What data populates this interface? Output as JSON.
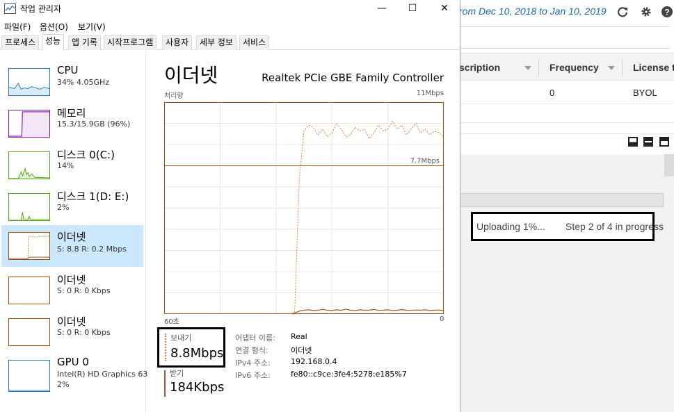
{
  "background_app": {
    "date_range": "rom Dec 10, 2018 to Jan 10, 2019",
    "columns": [
      "scription",
      "Frequency",
      "License t"
    ],
    "row": {
      "frequency": "0",
      "license": "BYOL"
    },
    "upload": {
      "status": "Uploading 1%...",
      "step": "Step 2 of 4 in progress"
    },
    "accent_color": "#1a66b3"
  },
  "task_manager": {
    "title": "작업 관리자",
    "window_controls": [
      "—",
      "☐",
      "✕"
    ],
    "menu": [
      "파일(F)",
      "옵션(O)",
      "보기(V)"
    ],
    "tabs": [
      "프로세스",
      "성능",
      "앱 기록",
      "시작프로그램",
      "사용자",
      "세부 정보",
      "서비스"
    ],
    "active_tab": "성능",
    "resources": [
      {
        "name": "CPU",
        "sub1": "34%  4.05GHz",
        "sub2": "",
        "color": "#1f7cc1"
      },
      {
        "name": "메모리",
        "sub1": "15.3/15.9GB (96%)",
        "sub2": "",
        "color": "#8b12ae"
      },
      {
        "name": "디스크 0(C:)",
        "sub1": "14%",
        "sub2": "",
        "color": "#4da60c"
      },
      {
        "name": "디스크 1(D: E:)",
        "sub1": "2%",
        "sub2": "",
        "color": "#4da60c"
      },
      {
        "name": "이더넷",
        "sub1": "S: 8.8  R: 0.2 Mbps",
        "sub2": "",
        "color": "#a74f01"
      },
      {
        "name": "이더넷",
        "sub1": "S: 0  R: 0 Kbps",
        "sub2": "",
        "color": "#a74f01"
      },
      {
        "name": "이더넷",
        "sub1": "S: 0  R: 0 Kbps",
        "sub2": "",
        "color": "#a74f01"
      },
      {
        "name": "GPU 0",
        "sub1": "Intel(R) HD Graphics 63",
        "sub2": "2%",
        "color": "#1f7cc1"
      }
    ],
    "detail": {
      "title": "이더넷",
      "adapter": "Realtek PCIe GBE Family Controller",
      "graph_label": "처리량",
      "max_label": "11Mbps",
      "mid_label": "7.7Mbps",
      "time_label": "60초",
      "zero_label": "0",
      "send_label": "보내기",
      "send_value": "8.8Mbps",
      "recv_label": "받기",
      "recv_value": "184Kbps",
      "info": [
        {
          "key": "어댑터 이름:",
          "value": "Real"
        },
        {
          "key": "연결 형식:",
          "value": "이더넷"
        },
        {
          "key": "IPv4 주소:",
          "value": "192.168.0.4"
        },
        {
          "key": "IPv6 주소:",
          "value": "fe80::c9ce:3fe4:5278:e185%7"
        }
      ]
    },
    "chart_data": {
      "type": "line",
      "y_unit": "Mbps",
      "ylim": [
        0,
        11
      ],
      "xlim": [
        60,
        0
      ],
      "grid": true,
      "series": [
        {
          "name": "보내기",
          "color": "#e0783a",
          "x": [
            60,
            59,
            58,
            57,
            56,
            55,
            54,
            53,
            52,
            51,
            50,
            49,
            48,
            47,
            46,
            45,
            44,
            43,
            42,
            41,
            40,
            39,
            38,
            37,
            36,
            35,
            34,
            33,
            32,
            31,
            30,
            29,
            28,
            27,
            26,
            25,
            24,
            23,
            22,
            21,
            20,
            19,
            18,
            17,
            16,
            15,
            14,
            13,
            12,
            11,
            10,
            9,
            8,
            7,
            6,
            5,
            4,
            3,
            2,
            1,
            0
          ],
          "values": [
            0,
            0,
            0,
            0,
            0,
            0,
            0,
            0,
            0,
            0,
            0,
            0,
            0,
            0,
            0,
            0,
            0,
            0,
            0,
            0,
            0,
            0,
            0,
            0,
            0,
            0,
            0,
            0,
            0.1,
            7.0,
            9.5,
            9.8,
            9.7,
            9.3,
            9.6,
            9.2,
            9.4,
            9.9,
            9.6,
            9.2,
            9.3,
            9.7,
            9.5,
            9.6,
            9.1,
            9.4,
            9.8,
            9.5,
            9.6,
            10.0,
            9.6,
            9.8,
            9.3,
            9.6,
            9.9,
            9.4,
            9.6,
            9.3,
            9.5,
            9.4,
            9.2
          ]
        },
        {
          "name": "받기",
          "color": "#a0522d",
          "x": [
            60,
            59,
            58,
            57,
            56,
            55,
            54,
            53,
            52,
            51,
            50,
            49,
            48,
            47,
            46,
            45,
            44,
            43,
            42,
            41,
            40,
            39,
            38,
            37,
            36,
            35,
            34,
            33,
            32,
            31,
            30,
            29,
            28,
            27,
            26,
            25,
            24,
            23,
            22,
            21,
            20,
            19,
            18,
            17,
            16,
            15,
            14,
            13,
            12,
            11,
            10,
            9,
            8,
            7,
            6,
            5,
            4,
            3,
            2,
            1,
            0
          ],
          "values": [
            0,
            0,
            0,
            0,
            0,
            0,
            0,
            0,
            0,
            0,
            0,
            0,
            0,
            0,
            0,
            0,
            0,
            0,
            0,
            0,
            0,
            0,
            0,
            0,
            0,
            0,
            0,
            0,
            0.05,
            0.15,
            0.2,
            0.22,
            0.18,
            0.2,
            0.24,
            0.2,
            0.18,
            0.22,
            0.2,
            0.25,
            0.2,
            0.18,
            0.22,
            0.2,
            0.2,
            0.24,
            0.19,
            0.2,
            0.22,
            0.18,
            0.2,
            0.23,
            0.2,
            0.19,
            0.21,
            0.2,
            0.22,
            0.18,
            0.2,
            0.21,
            0.18
          ]
        }
      ]
    }
  }
}
